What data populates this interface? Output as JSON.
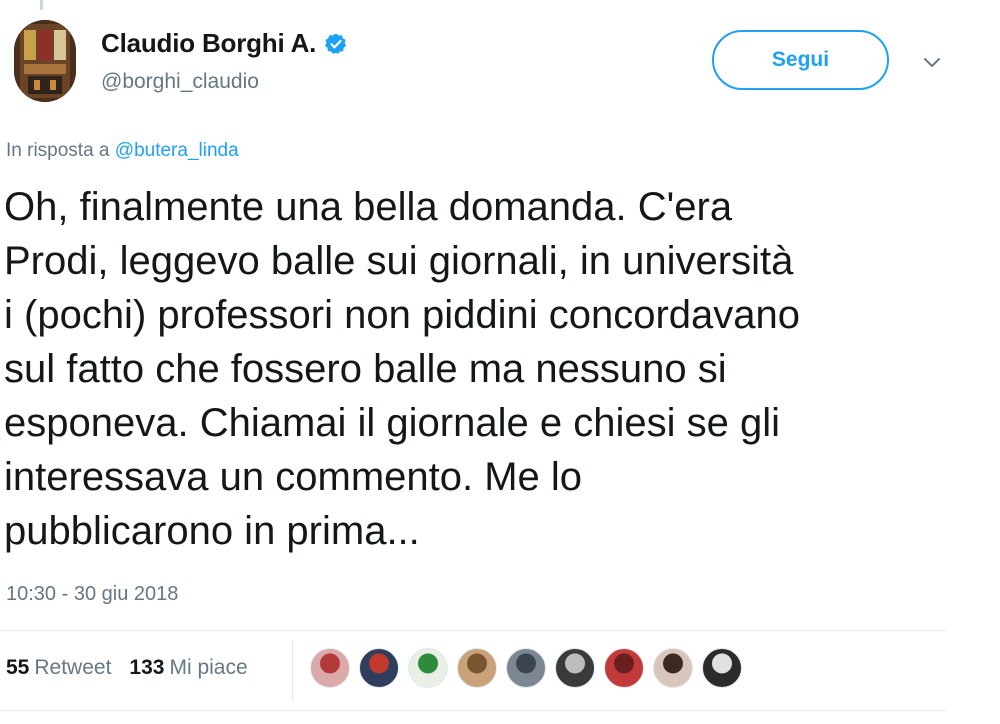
{
  "author": {
    "display_name": "Claudio Borghi A.",
    "handle": "@borghi_claudio",
    "verified_icon": "verified-badge-icon",
    "avatar_icon": "profile-picture"
  },
  "actions": {
    "follow_label": "Segui",
    "menu_icon": "chevron-down-icon"
  },
  "reply": {
    "prefix": "In risposta a",
    "mention": "@butera_linda"
  },
  "tweet": {
    "lines": [
      "Oh, finalmente una bella domanda. C'era",
      "Prodi, leggevo balle sui giornali, in università",
      "i (pochi) professori non piddini concordavano",
      "sul fatto che fossero balle ma nessuno si",
      "esponeva. Chiamai il giornale e chiesi se gli",
      "interessava un commento. Me lo",
      "pubblicarono in prima..."
    ],
    "timestamp": "10:30 - 30 giu 2018"
  },
  "stats": {
    "retweets_count": "55",
    "retweets_label": "Retweet",
    "likes_count": "133",
    "likes_label": "Mi piace"
  },
  "liked_by": [
    {
      "color": "#d9aaa8",
      "accent": "#b43a3a"
    },
    {
      "color": "#2f3e5c",
      "accent": "#c0392b"
    },
    {
      "color": "#e8efe4",
      "accent": "#2e8b3c"
    },
    {
      "color": "#c9a27a",
      "accent": "#7a5532"
    },
    {
      "color": "#7d8794",
      "accent": "#3c4450"
    },
    {
      "color": "#3a3a3a",
      "accent": "#bdbdbd"
    },
    {
      "color": "#c23a3a",
      "accent": "#6b1f1f"
    },
    {
      "color": "#d8c6bd",
      "accent": "#3b2a22"
    },
    {
      "color": "#2b2b2b",
      "accent": "#e0e0e0"
    }
  ],
  "colors": {
    "accent": "#1da1f2",
    "text": "#14171a",
    "muted": "#657786",
    "divider": "#e6ecf0"
  }
}
